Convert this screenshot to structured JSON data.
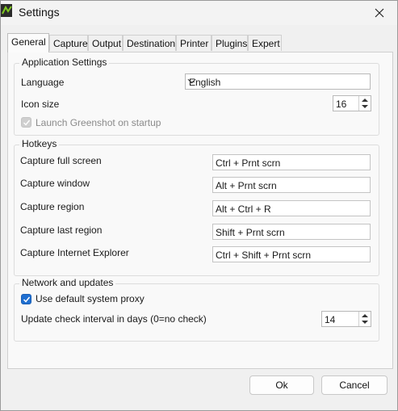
{
  "window": {
    "title": "Settings",
    "app_icon": "greenshot-icon",
    "close_icon": "close-icon"
  },
  "tabs": [
    {
      "label": "General",
      "active": true
    },
    {
      "label": "Capture"
    },
    {
      "label": "Output"
    },
    {
      "label": "Destination"
    },
    {
      "label": "Printer"
    },
    {
      "label": "Plugins"
    },
    {
      "label": "Expert"
    }
  ],
  "app_settings": {
    "legend": "Application Settings",
    "language_label": "Language",
    "language_value": "English",
    "icon_size_label": "Icon size",
    "icon_size_value": "16",
    "startup_label": "Launch Greenshot on startup",
    "startup_checked": true,
    "startup_enabled": false
  },
  "hotkeys": {
    "legend": "Hotkeys",
    "items": [
      {
        "label": "Capture full screen",
        "value": "Ctrl + Prnt scrn"
      },
      {
        "label": "Capture window",
        "value": "Alt + Prnt scrn"
      },
      {
        "label": "Capture region",
        "value": "Alt + Ctrl + R"
      },
      {
        "label": "Capture last region",
        "value": "Shift + Prnt scrn"
      },
      {
        "label": "Capture Internet Explorer",
        "value": "Ctrl + Shift + Prnt scrn"
      }
    ]
  },
  "network": {
    "legend": "Network and updates",
    "proxy_label": "Use default system proxy",
    "proxy_checked": true,
    "interval_label": "Update check interval in days (0=no check)",
    "interval_value": "14"
  },
  "buttons": {
    "ok": "Ok",
    "cancel": "Cancel"
  },
  "colors": {
    "accent": "#1f6fd1",
    "background": "#f0f0f0"
  }
}
